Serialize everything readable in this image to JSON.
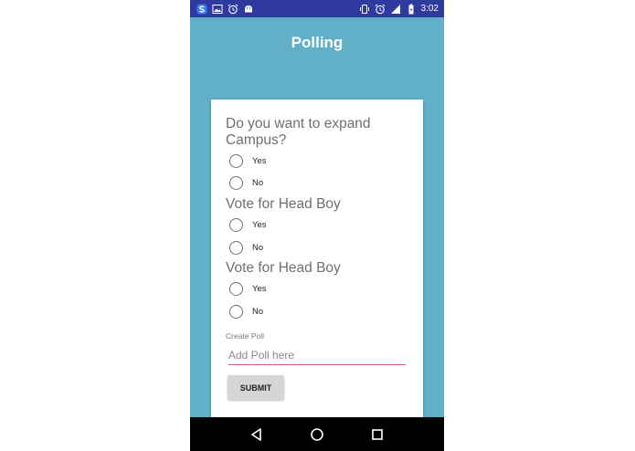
{
  "status_bar": {
    "time": "3:02",
    "left_icons": [
      "s-app-icon",
      "image-icon",
      "alarm-icon",
      "android-icon"
    ],
    "right_icons": [
      "vibrate-icon",
      "alarm-icon",
      "signal-icon",
      "battery-icon"
    ],
    "background": "#2f3a9e"
  },
  "app": {
    "title": "Polling",
    "background": "#62afc8"
  },
  "polls": [
    {
      "question": "Do you want to expand Campus?",
      "options": [
        "Yes",
        "No"
      ]
    },
    {
      "question": "Vote for Head Boy",
      "options": [
        "Yes",
        "No"
      ]
    },
    {
      "question": "Vote for Head Boy",
      "options": [
        "Yes",
        "No"
      ]
    }
  ],
  "create": {
    "label": "Create Poll",
    "placeholder": "Add Poll here",
    "value": "",
    "underline_color": "#d6507a",
    "submit_label": "SUBMIT"
  },
  "nav_bar": {
    "buttons": [
      "back-icon",
      "home-icon",
      "recents-icon"
    ]
  }
}
